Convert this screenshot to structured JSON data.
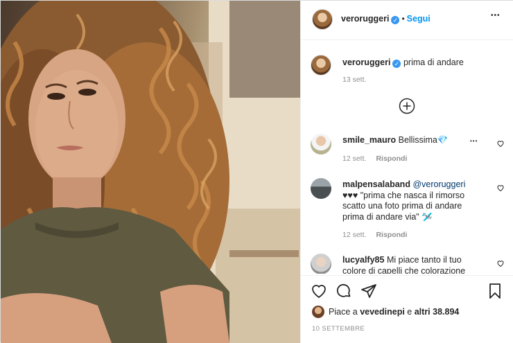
{
  "post": {
    "author": "veroruggeri",
    "follow_label": "Segui",
    "separator": "•",
    "more_glyph": "•••",
    "caption_author": "veroruggeri",
    "caption_text": "prima di andare",
    "caption_date": "13 sett."
  },
  "comments": [
    {
      "user": "smile_mauro",
      "text": "Bellissima",
      "emoji": "💎",
      "date": "12 sett.",
      "reply": "Rispondi",
      "more": "•••"
    },
    {
      "user": "malpensalaband",
      "mention": "@veroruggeri",
      "text_line1": "♥♥♥ \"prima che nasca il rimorso",
      "text_line2": "scatto una foto prima di andare",
      "text_line3": "prima di andare via\"",
      "emoji": "🛩️",
      "date": "12 sett.",
      "reply": "Rispondi"
    },
    {
      "user": "lucyalfy85",
      "text_line1": "Mi piace tanto il tuo",
      "text_line2": "colore di capelli che colorazione"
    }
  ],
  "footer": {
    "likes_prefix": "Piace a",
    "likes_user": "vevedinepi",
    "likes_mid": "e",
    "likes_count": "altri 38.894",
    "date": "10 SETTEMBRE"
  },
  "colors": {
    "accent": "#0095f6",
    "verified": "#3897f0",
    "muted": "#8e8e8e"
  },
  "icons": {
    "verified": "verified-badge-icon",
    "more": "more-options-icon",
    "load_more": "plus-circle-icon",
    "like": "heart-icon",
    "comment": "comment-bubble-icon",
    "share": "paper-plane-icon",
    "save": "bookmark-icon"
  }
}
